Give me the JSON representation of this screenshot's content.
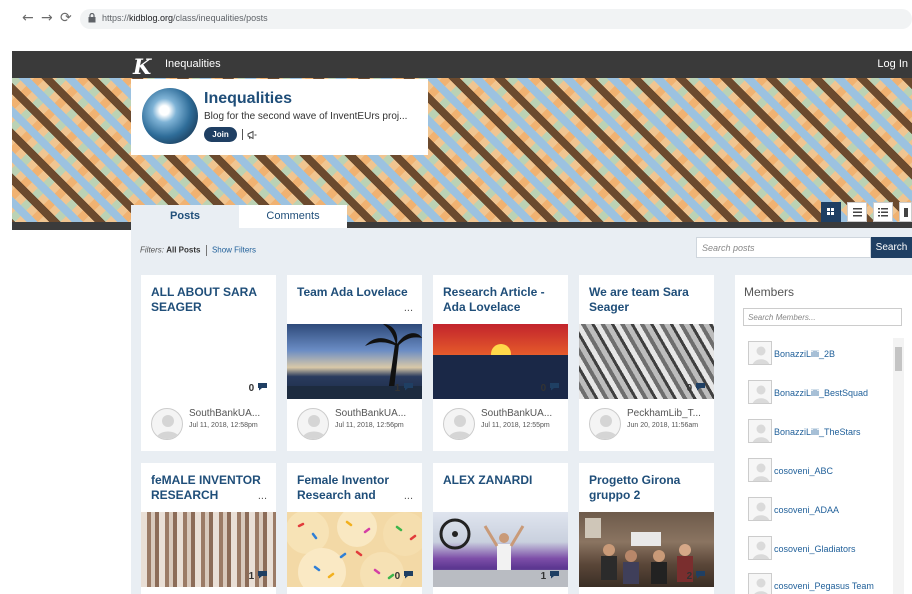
{
  "browser": {
    "url_scheme": "https://",
    "url_host": "kidblog.org",
    "url_path": "/class/inequalities/posts",
    "back_glyph": "←",
    "forward_glyph": "→",
    "reload_glyph": "⟳"
  },
  "topnav": {
    "logo": "K",
    "title": "Inequalities",
    "login_label": "Log In"
  },
  "blog": {
    "title": "Inequalities",
    "description": "Blog for the second wave of InventEUrs proj...",
    "join_label": "Join"
  },
  "tabs": [
    {
      "label": "Posts",
      "active": true
    },
    {
      "label": "Comments",
      "active": false
    }
  ],
  "filters": {
    "prefix": "Filters:",
    "current": "All Posts",
    "show_label": "Show Filters"
  },
  "search": {
    "placeholder": "Search posts",
    "button_label": "Search"
  },
  "posts": [
    {
      "title": "ALL ABOUT SARA SEAGER",
      "dots": "",
      "image": "none",
      "count": "0",
      "author": "SouthBankUA...",
      "date": "Jul 11, 2018, 12:58pm"
    },
    {
      "title": "Team Ada Lovelace",
      "dots": "...",
      "image": "sunset-palms",
      "count": "1",
      "author": "SouthBankUA...",
      "date": "Jul 11, 2018, 12:56pm"
    },
    {
      "title": "Research Article - Ada Lovelace",
      "dots": "",
      "image": "sunset-sea",
      "count": "0",
      "author": "SouthBankUA...",
      "date": "Jul 11, 2018, 12:55pm"
    },
    {
      "title": "We are team Sara Seager",
      "dots": "",
      "image": "grey-triangles",
      "count": "0",
      "author": "PeckhamLib_T...",
      "date": "Jun 20, 2018, 11:56am"
    },
    {
      "title": "feMALE INVENTOR RESEARCH",
      "dots": "...",
      "image": "birch-pattern",
      "count": "1",
      "author": "",
      "date": ""
    },
    {
      "title": "Female Inventor Research and",
      "dots": "...",
      "image": "sprinkle-cookies",
      "count": "0",
      "author": "",
      "date": ""
    },
    {
      "title": "ALEX ZANARDI",
      "dots": "",
      "image": "athlete",
      "count": "1",
      "author": "",
      "date": ""
    },
    {
      "title": "Progetto Girona gruppo 2",
      "dots": "",
      "image": "group-photo",
      "count": "2",
      "author": "",
      "date": ""
    }
  ],
  "members": {
    "heading": "Members",
    "search_placeholder": "Search Members...",
    "items": [
      "BonazziLilli_2B",
      "BonazziLilli_BestSquad",
      "BonazziLilli_TheStars",
      "cosoveni_ABC",
      "cosoveni_ADAA",
      "cosoveni_Gladiators",
      "cosoveni_Pegasus Team"
    ]
  },
  "colors": {
    "navy": "#1f3f63",
    "title_blue": "#1f4e79",
    "link_blue": "#1f5f99",
    "topnav": "#3a3a3a",
    "content_bg": "#e9eef3"
  }
}
